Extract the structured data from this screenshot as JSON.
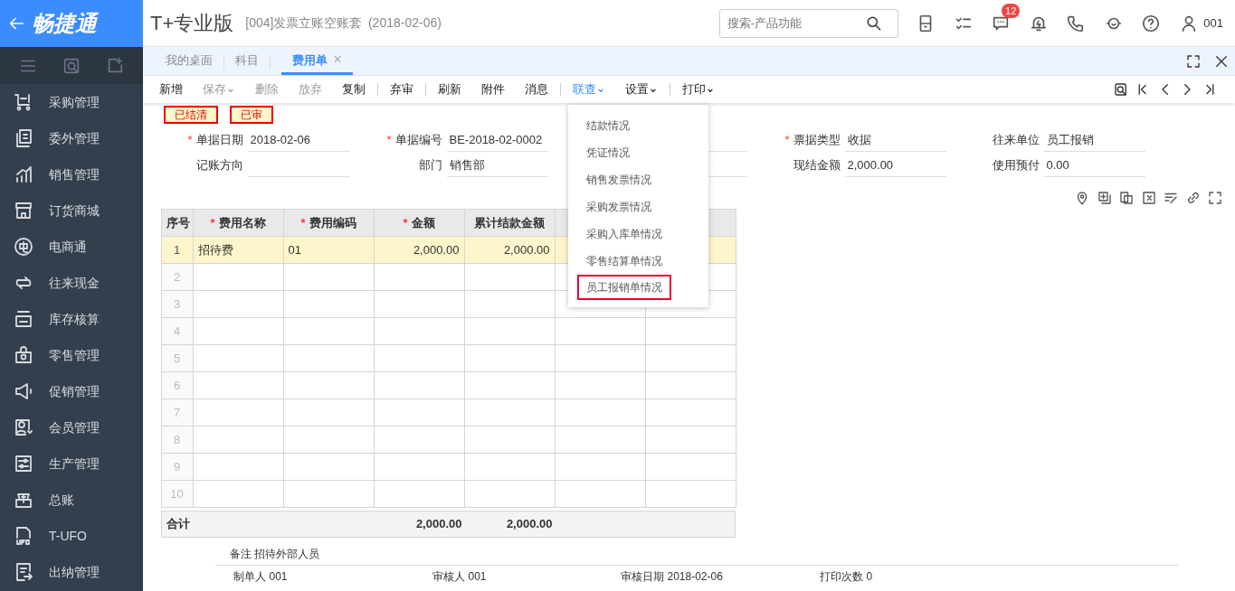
{
  "header": {
    "logo_main": "畅捷通",
    "logo_edition": "T+专业版",
    "account": "[004]发票立账空账套",
    "date": "(2018-02-06)",
    "search": {
      "placeholder": "搜索-产品功能"
    },
    "message_badge": "12",
    "user": "001"
  },
  "sidebar": {
    "items": [
      {
        "label": "采购管理"
      },
      {
        "label": "委外管理"
      },
      {
        "label": "销售管理"
      },
      {
        "label": "订货商城"
      },
      {
        "label": "电商通"
      },
      {
        "label": "往来现金"
      },
      {
        "label": "库存核算"
      },
      {
        "label": "零售管理"
      },
      {
        "label": "促销管理"
      },
      {
        "label": "会员管理"
      },
      {
        "label": "生产管理"
      },
      {
        "label": "总账"
      },
      {
        "label": "T-UFO"
      },
      {
        "label": "出纳管理"
      }
    ]
  },
  "tabs": [
    {
      "label": "我的桌面",
      "selected": false
    },
    {
      "label": "科目",
      "selected": false
    },
    {
      "label": "费用单",
      "selected": true,
      "close": "×"
    }
  ],
  "toolbar": [
    {
      "kind": "button",
      "label": "新增",
      "disabled": false,
      "dropdown": false,
      "selected": false
    },
    {
      "kind": "button",
      "label": "保存",
      "disabled": true,
      "dropdown": true,
      "selected": false
    },
    {
      "kind": "button",
      "label": "删除",
      "disabled": true,
      "dropdown": false,
      "selected": false
    },
    {
      "kind": "button",
      "label": "放弃",
      "disabled": true,
      "dropdown": false,
      "selected": false
    },
    {
      "kind": "button",
      "label": "复制",
      "disabled": false,
      "dropdown": false,
      "selected": false
    },
    {
      "kind": "separator"
    },
    {
      "kind": "button",
      "label": "弃审",
      "disabled": false,
      "dropdown": false,
      "selected": false
    },
    {
      "kind": "separator"
    },
    {
      "kind": "button",
      "label": "刷新",
      "disabled": false,
      "dropdown": false,
      "selected": false
    },
    {
      "kind": "button",
      "label": "附件",
      "disabled": false,
      "dropdown": false,
      "selected": false
    },
    {
      "kind": "button",
      "label": "消息",
      "disabled": false,
      "dropdown": false,
      "selected": false
    },
    {
      "kind": "separator"
    },
    {
      "kind": "button",
      "label": "联查",
      "disabled": false,
      "dropdown": true,
      "selected": true
    },
    {
      "kind": "button",
      "label": "设置",
      "disabled": false,
      "dropdown": true,
      "selected": false
    },
    {
      "kind": "separator"
    },
    {
      "kind": "button",
      "label": "打印",
      "disabled": false,
      "dropdown": true,
      "selected": false
    }
  ],
  "stamps": [
    "已结清",
    "已审"
  ],
  "form_rows": [
    [
      {
        "mark": "*",
        "label": "单据日期",
        "value": "2018-02-06"
      },
      {
        "mark": "*",
        "label": "单据编号",
        "value": "BE-2018-02-0002"
      },
      {
        "mark": "*",
        "label": "票据类型",
        "value": "收据"
      },
      {
        "label": "往来单位",
        "value": "员工报销"
      }
    ],
    [
      {
        "label": "记账方向"
      },
      {
        "label": "部门",
        "value": "销售部"
      },
      {
        "label": "现结金额",
        "value": "2,000.00"
      },
      {
        "label": "使用预付",
        "value": "0.00"
      }
    ]
  ],
  "dropdown_menu": [
    {
      "label": "结款情况",
      "highlighted": false
    },
    {
      "label": "凭证情况",
      "highlighted": false
    },
    {
      "label": "销售发票情况",
      "highlighted": false
    },
    {
      "label": "采购发票情况",
      "highlighted": false
    },
    {
      "label": "采购入库单情况",
      "highlighted": false
    },
    {
      "label": "零售结算单情况",
      "highlighted": false
    },
    {
      "label": "员工报销单情况",
      "highlighted": true
    }
  ],
  "table": {
    "columns": [
      {
        "label": "序号"
      },
      {
        "mark": "*",
        "label": "费用名称"
      },
      {
        "mark": "*",
        "label": "费用编码"
      },
      {
        "mark": "*",
        "label": "金额"
      },
      {
        "label": "累计结款金额"
      },
      {},
      {}
    ],
    "rows": [
      {
        "selected": true,
        "cells": [
          "1",
          "招待费",
          "01",
          "2,000.00",
          "2,000.00"
        ]
      },
      {
        "selected": false,
        "cells": [
          "2"
        ]
      },
      {
        "selected": false,
        "cells": [
          "3"
        ]
      },
      {
        "selected": false,
        "cells": [
          "4"
        ]
      },
      {
        "selected": false,
        "cells": [
          "5"
        ]
      },
      {
        "selected": false,
        "cells": [
          "6"
        ]
      },
      {
        "selected": false,
        "cells": [
          "7"
        ]
      },
      {
        "selected": false,
        "cells": [
          "8"
        ]
      },
      {
        "selected": false,
        "cells": [
          "9"
        ]
      },
      {
        "selected": false,
        "cells": [
          "10"
        ]
      }
    ],
    "total": {
      "label": "合计",
      "amount": "2,000.00",
      "settled_amount": "2,000.00"
    }
  },
  "remark": {
    "label": "备注",
    "value": "招待外部人员"
  },
  "footer": [
    {
      "label": "制单人",
      "value": "001"
    },
    {
      "label": "审核人",
      "value": "001"
    },
    {
      "label": "审核日期",
      "value": "2018-02-06"
    },
    {
      "label": "打印次数",
      "value": "0"
    }
  ]
}
